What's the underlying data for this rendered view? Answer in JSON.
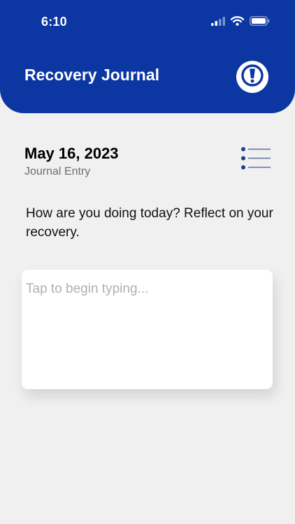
{
  "status_bar": {
    "time": "6:10",
    "icons": [
      "cellular-signal-icon",
      "wifi-icon",
      "battery-icon"
    ]
  },
  "header": {
    "title": "Recovery Journal",
    "background_color": "#0c36a1",
    "action_icon": "alert-exclamation-icon"
  },
  "entry": {
    "date": "May 16, 2023",
    "subtitle": "Journal Entry",
    "list_icon": "list-icon",
    "prompt": "How are you doing today? Reflect on your recovery.",
    "text_value": "",
    "placeholder": "Tap to begin typing..."
  },
  "colors": {
    "accent": "#0c36a1",
    "background": "#f0f0f0",
    "card": "#ffffff",
    "subtitle_text": "#6e6e6e",
    "placeholder_text": "#b0b0b0"
  }
}
